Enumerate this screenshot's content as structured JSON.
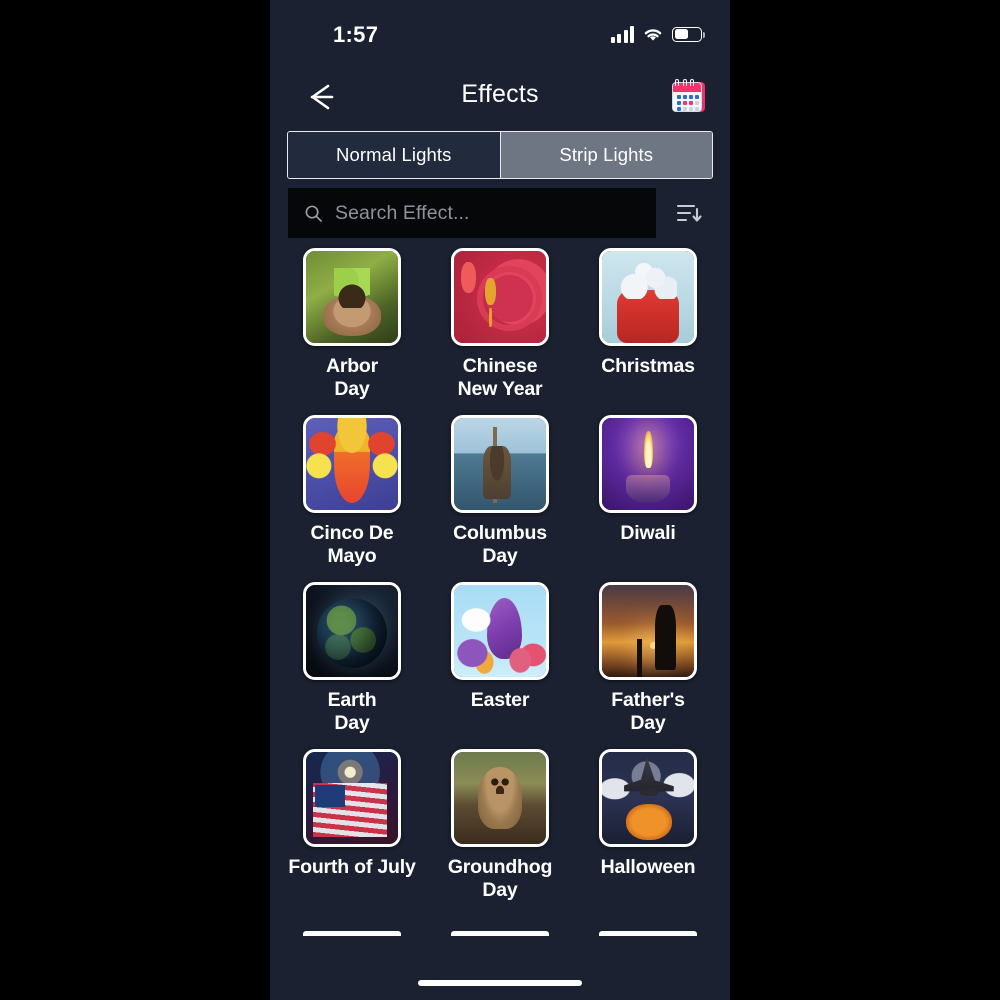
{
  "status_bar": {
    "time": "1:57",
    "signal_icon": "cellular-signal-icon",
    "wifi_icon": "wifi-icon",
    "battery_icon": "battery-icon",
    "battery_level_percent": 52
  },
  "nav": {
    "back_icon": "back-arrow-icon",
    "title": "Effects",
    "calendar_icon": "calendar-icon"
  },
  "tabs": {
    "items": [
      {
        "label": "Normal Lights",
        "active": false
      },
      {
        "label": "Strip Lights",
        "active": true
      }
    ]
  },
  "search": {
    "icon": "search-icon",
    "value": "",
    "placeholder": "Search Effect...",
    "sort_icon": "sort-descending-icon"
  },
  "grid": {
    "items": [
      {
        "label": "Arbor\nDay",
        "line1": "Arbor",
        "line2": "Day",
        "art": "art-arbor"
      },
      {
        "label": "Chinese New Year",
        "line1": "Chinese",
        "line2": "New Year",
        "art": "art-cny"
      },
      {
        "label": "Christmas",
        "line1": "Christmas",
        "line2": "",
        "art": "art-xmas"
      },
      {
        "label": "Cinco De Mayo",
        "line1": "Cinco De Mayo",
        "line2": "",
        "art": "art-cinco"
      },
      {
        "label": "Columbus Day",
        "line1": "Columbus",
        "line2": "Day",
        "art": "art-columbus"
      },
      {
        "label": "Diwali",
        "line1": "Diwali",
        "line2": "",
        "art": "art-diwali"
      },
      {
        "label": "Earth Day",
        "line1": "Earth",
        "line2": "Day",
        "art": "art-earth"
      },
      {
        "label": "Easter",
        "line1": "Easter",
        "line2": "",
        "art": "art-easter"
      },
      {
        "label": "Father's Day",
        "line1": "Father's",
        "line2": "Day",
        "art": "art-fathers"
      },
      {
        "label": "Fourth of July",
        "line1": "Fourth of July",
        "line2": "",
        "art": "art-july"
      },
      {
        "label": "Groundhog Day",
        "line1": "Groundhog",
        "line2": "Day",
        "art": "art-groundhog"
      },
      {
        "label": "Halloween",
        "line1": "Halloween",
        "line2": "",
        "art": "art-halloween"
      }
    ]
  },
  "colors": {
    "screen_background": "#1b2130",
    "tab_active_background": "#6e7684",
    "tab_inactive_background": "#222a3d",
    "search_background": "#060709",
    "text_primary": "#ffffff",
    "text_placeholder": "#8d939d",
    "calendar_accent": "#f0356c"
  },
  "home_indicator": "home-indicator"
}
